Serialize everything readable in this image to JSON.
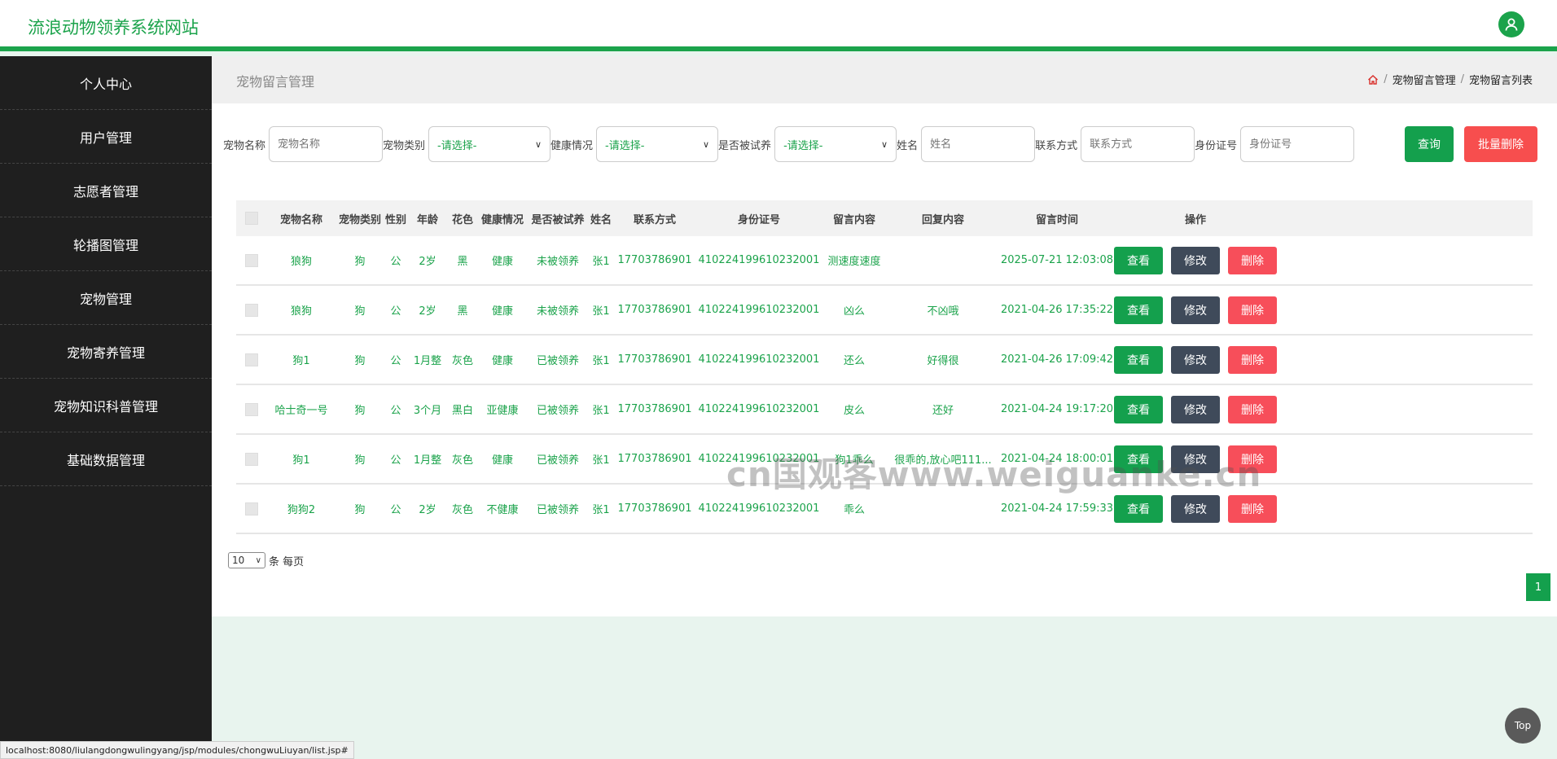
{
  "header": {
    "site_title": "流浪动物领养系统网站"
  },
  "sidebar": {
    "items": [
      {
        "label": "个人中心"
      },
      {
        "label": "用户管理"
      },
      {
        "label": "志愿者管理"
      },
      {
        "label": "轮播图管理"
      },
      {
        "label": "宠物管理"
      },
      {
        "label": "宠物寄养管理"
      },
      {
        "label": "宠物知识科普管理"
      },
      {
        "label": "基础数据管理"
      }
    ]
  },
  "page": {
    "title": "宠物留言管理",
    "breadcrumb": [
      "宠物留言管理",
      "宠物留言列表"
    ],
    "breadcrumb_sep": "/"
  },
  "search": {
    "pet_name_label": "宠物名称",
    "pet_name_placeholder": "宠物名称",
    "pet_type_label": "宠物类别",
    "pet_type_value": "-请选择-",
    "health_label": "健康情况",
    "health_value": "-请选择-",
    "trial_label": "是否被试养",
    "trial_value": "-请选择-",
    "name_label": "姓名",
    "name_placeholder": "姓名",
    "contact_label": "联系方式",
    "contact_placeholder": "联系方式",
    "id_label": "身份证号",
    "id_placeholder": "身份证号",
    "query_btn": "查询",
    "batch_delete_btn": "批量删除"
  },
  "table": {
    "headers": [
      "宠物名称",
      "宠物类别",
      "性别",
      "年龄",
      "花色",
      "健康情况",
      "是否被试养",
      "姓名",
      "联系方式",
      "身份证号",
      "留言内容",
      "回复内容",
      "留言时间",
      "操作"
    ],
    "rows": [
      [
        "狼狗",
        "狗",
        "公",
        "2岁",
        "黑",
        "健康",
        "未被领养",
        "张1",
        "17703786901",
        "410224199610232001",
        "测速度速度",
        "",
        "2025-07-21 12:03:08"
      ],
      [
        "狼狗",
        "狗",
        "公",
        "2岁",
        "黑",
        "健康",
        "未被领养",
        "张1",
        "17703786901",
        "410224199610232001",
        "凶么",
        "不凶哦",
        "2021-04-26 17:35:22"
      ],
      [
        "狗1",
        "狗",
        "公",
        "1月整",
        "灰色",
        "健康",
        "已被领养",
        "张1",
        "17703786901",
        "410224199610232001",
        "还么",
        "好得很",
        "2021-04-26 17:09:42"
      ],
      [
        "哈士奇一号",
        "狗",
        "公",
        "3个月",
        "黑白",
        "亚健康",
        "已被领养",
        "张1",
        "17703786901",
        "410224199610232001",
        "皮么",
        "还好",
        "2021-04-24 19:17:20"
      ],
      [
        "狗1",
        "狗",
        "公",
        "1月整",
        "灰色",
        "健康",
        "已被领养",
        "张1",
        "17703786901",
        "410224199610232001",
        "狗1乖么",
        "很乖的,放心吧111...",
        "2021-04-24 18:00:01"
      ],
      [
        "狗狗2",
        "狗",
        "公",
        "2岁",
        "灰色",
        "不健康",
        "已被领养",
        "张1",
        "17703786901",
        "410224199610232001",
        "乖么",
        "",
        "2021-04-24 17:59:33"
      ]
    ],
    "actions": {
      "view": "查看",
      "edit": "修改",
      "delete": "删除"
    }
  },
  "pagination": {
    "page_size": "10",
    "per_page_text": "条 每页",
    "current_page": "1"
  },
  "watermark": "cn国观客www.weiguanke.cn",
  "status_url": "localhost:8080/liulangdongwulingyang/jsp/modules/chongwuLiuyan/list.jsp#",
  "top_button": "Top",
  "colors": {
    "brand": "#1ba34b",
    "danger": "#f74e4e",
    "dark": "#1f1f1f"
  }
}
